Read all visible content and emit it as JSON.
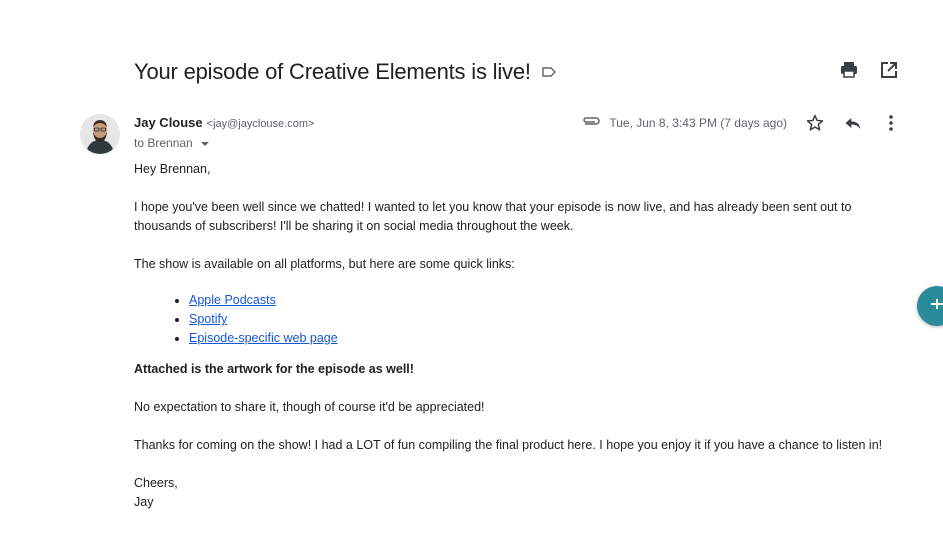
{
  "email": {
    "subject": "Your episode of Creative Elements is live!",
    "sender_name": "Jay Clouse",
    "sender_email": "<jay@jayclouse.com>",
    "to_line": "to Brennan",
    "date": "Tue, Jun 8, 3:43 PM (7 days ago)",
    "greeting": "Hey Brennan,",
    "para1": "I hope you've been well since we chatted! I wanted to let you know that your episode is now live, and has already been sent out to thousands of subscribers! I'll be sharing it on social media throughout the week.",
    "para2": "The show is available on all platforms, but here are some quick links:",
    "links": [
      "Apple Podcasts",
      "Spotify",
      "Episode-specific web page "
    ],
    "para3_bold": "Attached is the artwork for the episode as well!",
    "para4": "No expectation to share it, though of course it'd be appreciated!",
    "para5": "Thanks for coming on the show! I had a LOT of fun compiling the final product here. I hope you enjoy it if you have a chance to listen in!",
    "signoff": "Cheers,",
    "signature": "Jay"
  },
  "icons": {
    "label": "label-outline-icon",
    "print": "print-icon",
    "open_new": "open-in-new-window-icon",
    "attachment": "paperclip-icon",
    "star": "star-icon",
    "reply": "reply-icon",
    "more": "more-vertical-icon",
    "fab": "side-panel-icon"
  },
  "colors": {
    "link": "#1558d6",
    "fab": "#2a8c9a",
    "muted": "#5f6368"
  }
}
